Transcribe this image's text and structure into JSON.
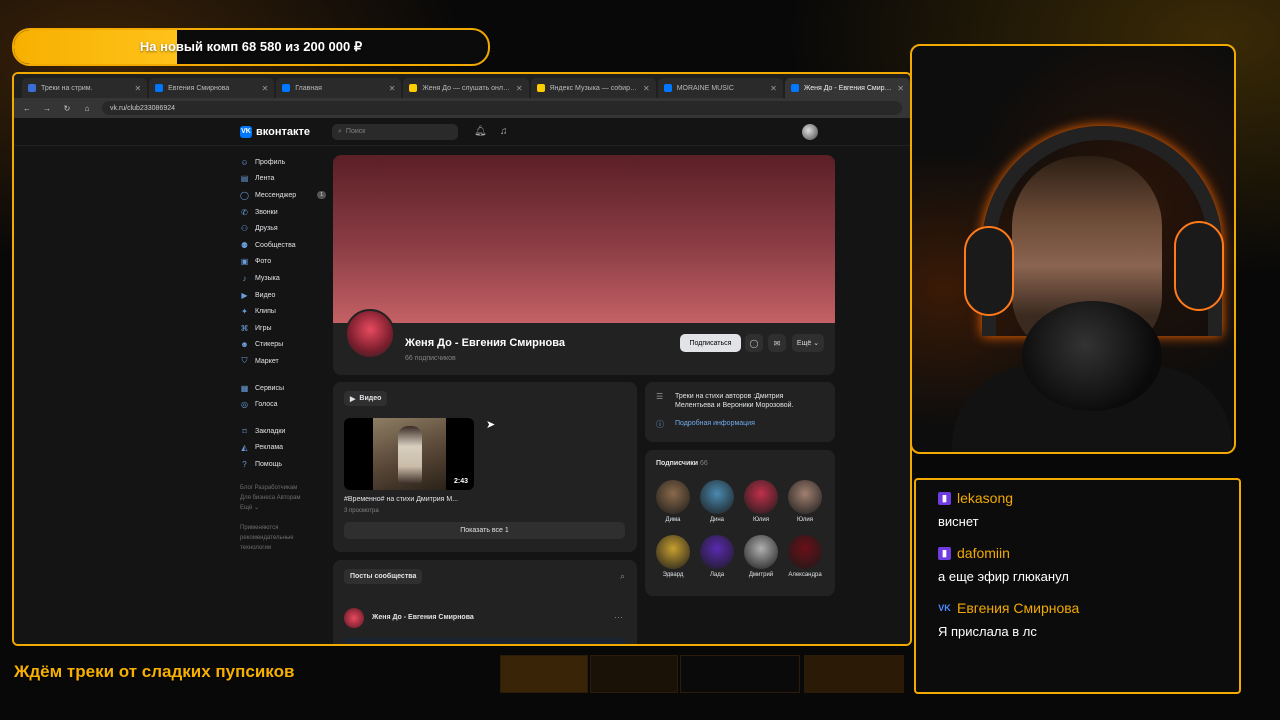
{
  "overlay": {
    "goal_text": "На новый комп 68 580  из 200 000 ₽",
    "goal_progress": 0.343,
    "ticker": "Ждём треки от сладких пупсиков",
    "accent_color": "#f2a900"
  },
  "browser": {
    "tabs": [
      {
        "label": "Треки на стрим.",
        "icon": "bars-icon",
        "color": "#3b6fd8"
      },
      {
        "label": "Евгения Смирнова",
        "icon": "vk-icon",
        "color": "#0077ff"
      },
      {
        "label": "Главная",
        "icon": "vk-icon",
        "color": "#0077ff"
      },
      {
        "label": "Женя До — слушать онлайн с",
        "icon": "yandex-music-icon",
        "color": "#ffcc00"
      },
      {
        "label": "Яндекс Музыка — собираем м",
        "icon": "yandex-music-icon",
        "color": "#ffcc00"
      },
      {
        "label": "MORAINE MUSIC",
        "icon": "vk-icon",
        "color": "#0077ff"
      },
      {
        "label": "Женя До - Евгения Смирнова",
        "icon": "vk-icon",
        "color": "#0077ff"
      }
    ],
    "active_tab": 6,
    "url": "vk.ru/club233086924"
  },
  "vk": {
    "logo_text": "вконтакте",
    "search_placeholder": "Поиск",
    "sidebar": [
      {
        "label": "Профиль",
        "icon": "user-icon"
      },
      {
        "label": "Лента",
        "icon": "feed-icon"
      },
      {
        "label": "Мессенджер",
        "icon": "chat-icon",
        "badge": "1"
      },
      {
        "label": "Звонки",
        "icon": "phone-icon"
      },
      {
        "label": "Друзья",
        "icon": "friends-icon"
      },
      {
        "label": "Сообщества",
        "icon": "groups-icon"
      },
      {
        "label": "Фото",
        "icon": "photo-icon"
      },
      {
        "label": "Музыка",
        "icon": "music-icon"
      },
      {
        "label": "Видео",
        "icon": "video-icon"
      },
      {
        "label": "Клипы",
        "icon": "clips-icon"
      },
      {
        "label": "Игры",
        "icon": "games-icon"
      },
      {
        "label": "Стикеры",
        "icon": "stickers-icon"
      },
      {
        "label": "Маркет",
        "icon": "market-icon"
      }
    ],
    "sidebar2": [
      {
        "label": "Сервисы",
        "icon": "services-icon"
      },
      {
        "label": "Голоса",
        "icon": "votes-icon"
      }
    ],
    "sidebar3": [
      {
        "label": "Закладки",
        "icon": "bookmark-icon"
      },
      {
        "label": "Реклама",
        "icon": "ads-icon"
      },
      {
        "label": "Помощь",
        "icon": "help-icon"
      }
    ],
    "footer_links": {
      "line1": "Блог   Разработчикам",
      "line2": "Для бизнеса   Авторам",
      "line3": "Ещё ⌄"
    },
    "footer_note": "Применяются рекомендательные технологии",
    "community": {
      "name": "Женя До - Евгения Смирнова",
      "subscribers": "66 подписчиков",
      "subscribe_button": "Подписаться",
      "more_button": "Ещё ⌄"
    },
    "video": {
      "label": "Видео",
      "duration": "2:43",
      "title": "#Временно# на стихи Дмитрия М...",
      "views": "3 просмотра",
      "show_all": "Показать все 1"
    },
    "info": {
      "text": "Треки на стихи авторов :Дмитрия Мелентьева и Вероники Морозовой.",
      "link": "Подробная информация"
    },
    "subscribers_block": {
      "title": "Подписчики",
      "count": "66",
      "people": [
        {
          "name": "Дима",
          "color": "#8a6a4a"
        },
        {
          "name": "Дина",
          "color": "#4a8ab0"
        },
        {
          "name": "Юлия",
          "color": "#c0304a"
        },
        {
          "name": "Юлия",
          "color": "#a08070"
        },
        {
          "name": "Эдвард",
          "color": "#c8a030"
        },
        {
          "name": "Лада",
          "color": "#5a2ab0"
        },
        {
          "name": "Дмитрий",
          "color": "#b0b0b0"
        },
        {
          "name": "Александра",
          "color": "#6a1018"
        }
      ]
    },
    "posts": {
      "label": "Посты сообщества",
      "author": "Женя До - Евгения Смирнова"
    }
  },
  "chat": [
    {
      "user": "lekasong",
      "platform": "twitch",
      "text": "виснет",
      "color": "#f2a900"
    },
    {
      "user": "dafomiin",
      "platform": "twitch",
      "text": "а еще эфир глюканул",
      "color": "#f2a900"
    },
    {
      "user": "Евгения Смирнова",
      "platform": "vk",
      "text": "Я прислала в лс",
      "color": "#f2a900"
    }
  ]
}
